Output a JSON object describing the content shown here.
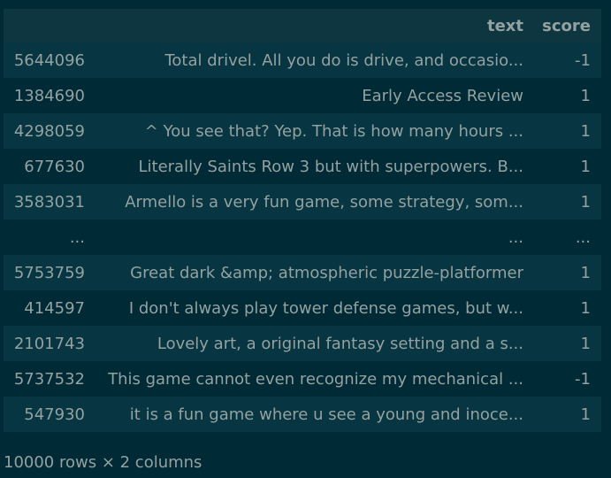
{
  "table": {
    "columns": [
      "text",
      "score"
    ],
    "rows": [
      {
        "index": "5644096",
        "text": "Total drivel. All you do is drive, and occasio...",
        "score": "-1"
      },
      {
        "index": "1384690",
        "text": "Early Access Review",
        "score": "1"
      },
      {
        "index": "4298059",
        "text": "^ You see that? Yep. That is how many hours ...",
        "score": "1"
      },
      {
        "index": "677630",
        "text": "Literally Saints Row 3 but with superpowers. B...",
        "score": "1"
      },
      {
        "index": "3583031",
        "text": "Armello is a very fun game, some strategy, som...",
        "score": "1"
      },
      {
        "index": "...",
        "text": "...",
        "score": "..."
      },
      {
        "index": "5753759",
        "text": "Great dark &amp; atmospheric puzzle-platformer",
        "score": "1"
      },
      {
        "index": "414597",
        "text": "I don't always play tower defense games, but w...",
        "score": "1"
      },
      {
        "index": "2101743",
        "text": "Lovely art, a original fantasy setting and a s...",
        "score": "1"
      },
      {
        "index": "5737532",
        "text": "This game cannot even recognize my mechanical ...",
        "score": "-1"
      },
      {
        "index": "547930",
        "text": "it is a fun game where u see a young and inoce...",
        "score": "1"
      }
    ]
  },
  "footer": {
    "dimensions": "10000 rows × 2 columns"
  },
  "colors": {
    "background": "#002b36",
    "row_alt": "#073642",
    "header": "#0d3641",
    "text": "#93a1a1"
  }
}
